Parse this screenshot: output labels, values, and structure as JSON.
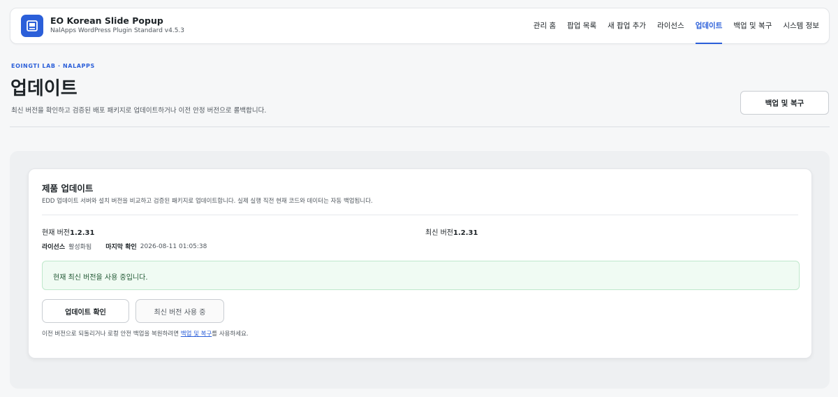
{
  "header": {
    "title": "EO Korean Slide Popup",
    "subtitle": "NalApps WordPress Plugin Standard v4.5.3",
    "logo_icon": "monitor-document-icon",
    "accent": "#2b5fd9"
  },
  "nav": {
    "items": [
      {
        "label": "관리 홈",
        "active": false
      },
      {
        "label": "팝업 목록",
        "active": false
      },
      {
        "label": "새 팝업 추가",
        "active": false
      },
      {
        "label": "라이선스",
        "active": false
      },
      {
        "label": "업데이트",
        "active": true
      },
      {
        "label": "백업 및 복구",
        "active": false
      },
      {
        "label": "시스템 정보",
        "active": false
      }
    ]
  },
  "page": {
    "eyebrow": "EOINGTI LAB · NALAPPS",
    "title": "업데이트",
    "description": "최신 버전을 확인하고 검증된 배포 패키지로 업데이트하거나 이전 안정 버전으로 롤백합니다.",
    "backup_button": "백업 및 복구"
  },
  "card": {
    "title": "제품 업데이트",
    "description": "EDD 업데이트 서버와 설치 버전을 비교하고 검증된 패키지로 업데이트합니다. 실제 실행 직전 현재 코드와 데이터는 자동 백업됩니다.",
    "current_label": "현재 버전",
    "current_value": "1.2.31",
    "latest_label": "최신 버전",
    "latest_value": "1.2.31",
    "license_label": "라이선스",
    "license_value": "활성화됨",
    "last_check_label": "마지막 확인",
    "last_check_value": "2026-08-11 01:05:38",
    "notice": "현재 최신 버전을 사용 중입니다.",
    "notice_color": "#f0fbf3",
    "check_button": "업데이트 확인",
    "latest_button": "최신 버전 사용 중",
    "footer_prefix": "이전 버전으로 되돌리거나 로컬 안전 백업을 복원하려면 ",
    "footer_link": "백업 및 복구",
    "footer_suffix": "를 사용하세요."
  }
}
